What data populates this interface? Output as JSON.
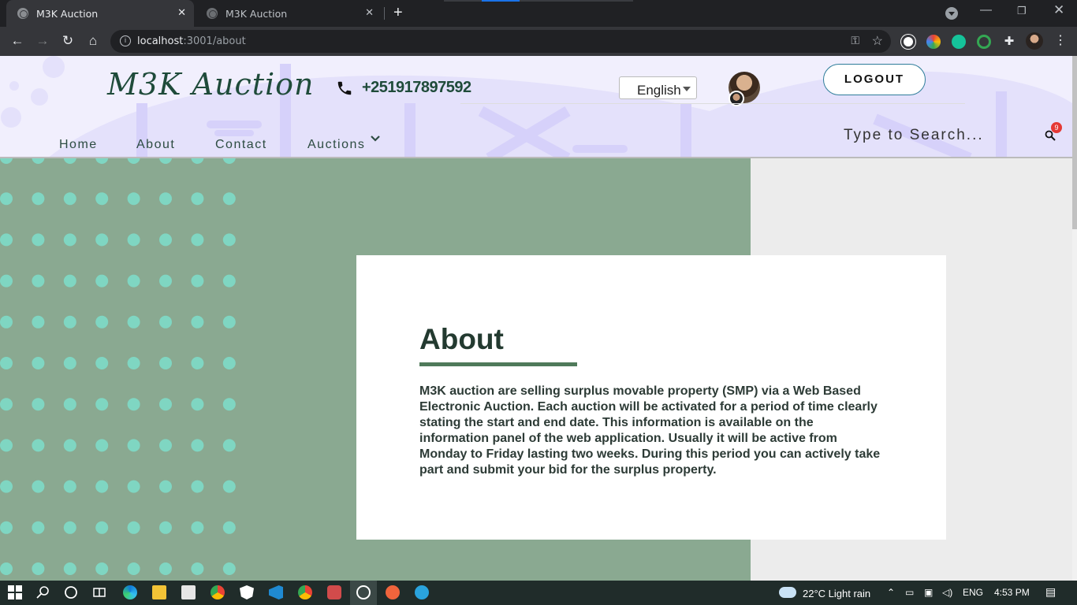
{
  "browser": {
    "tabs": [
      {
        "title": "M3K Auction",
        "active": true
      },
      {
        "title": "M3K Auction",
        "active": false
      }
    ],
    "url_host": "localhost",
    "url_path": ":3001/about",
    "new_tab_symbol": "+",
    "close_symbol": "✕"
  },
  "header": {
    "logo": "M3K Auction",
    "phone": "+251917897592",
    "language": "English",
    "logout_label": "LOGOUT",
    "nav": [
      "Home",
      "About",
      "Contact",
      "Auctions"
    ],
    "search_placeholder": "Type to Search...",
    "notification_count": "9"
  },
  "about": {
    "title": "About",
    "body": "M3K auction are selling surplus movable property (SMP) via a Web Based Electronic Auction. Each auction will be activated for a period of time clearly stating the start and end date. This information is available on the information panel of the web application. Usually it will be active from Monday to Friday lasting two weeks. During this period you can actively take part and submit your bid for the surplus property."
  },
  "taskbar": {
    "weather": "22°C  Light rain",
    "language": "ENG",
    "time": "4:53 PM"
  },
  "colors": {
    "green_panel": "#8aa991",
    "dots": "#7fd6c2",
    "heading": "#233a30",
    "header_bg": "#f1effd"
  }
}
